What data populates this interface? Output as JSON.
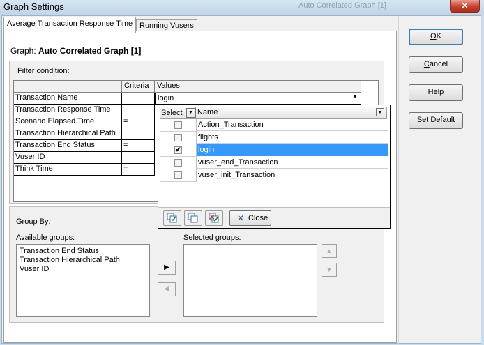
{
  "window": {
    "title": "Graph Settings",
    "ghost_title": "Auto Correlated Graph [1]",
    "close_glyph": "✕"
  },
  "tabs": [
    {
      "label": "Average Transaction Response Time",
      "active": true
    },
    {
      "label": "Running Vusers",
      "active": false
    }
  ],
  "graph": {
    "label": "Graph:",
    "name": "Auto Correlated Graph [1]"
  },
  "filter": {
    "title": "Filter condition:",
    "headers": {
      "criteria": "Criteria",
      "values": "Values"
    },
    "rows": [
      {
        "name": "Transaction Name",
        "criteria": "",
        "value": "login"
      },
      {
        "name": "Transaction Response Time",
        "criteria": "",
        "value": ""
      },
      {
        "name": "Scenario Elapsed Time",
        "criteria": "=",
        "value": ""
      },
      {
        "name": "Transaction Hierarchical Path",
        "criteria": "",
        "value": ""
      },
      {
        "name": "Transaction End Status",
        "criteria": "=",
        "value": ""
      },
      {
        "name": "Vuser ID",
        "criteria": "",
        "value": ""
      },
      {
        "name": "Think Time",
        "criteria": "=",
        "value": ""
      }
    ]
  },
  "dropdown": {
    "header_select": "Select",
    "header_name": "Name",
    "items": [
      {
        "name": "Action_Transaction",
        "checked": false,
        "selected": false
      },
      {
        "name": "flights",
        "checked": false,
        "selected": false
      },
      {
        "name": "login",
        "checked": true,
        "selected": true
      },
      {
        "name": "vuser_end_Transaction",
        "checked": false,
        "selected": false
      },
      {
        "name": "vuser_init_Transaction",
        "checked": false,
        "selected": false
      }
    ],
    "close_label": "Close"
  },
  "group_by": {
    "title": "Group By:",
    "available_label": "Available groups:",
    "available": [
      "Transaction End Status",
      "Transaction Hierarchical Path",
      "Vuser ID"
    ],
    "selected_label": "Selected groups:",
    "selected": []
  },
  "buttons": {
    "ok_accel": "O",
    "ok_rest": "K",
    "cancel_accel": "C",
    "cancel_rest": "ancel",
    "help_accel": "H",
    "help_rest": "elp",
    "setdefault_accel": "S",
    "setdefault_rest": "et Default"
  },
  "colors": {
    "selection": "#3399ff",
    "window": "#f0f0f0",
    "frame": "#c9dceb"
  }
}
